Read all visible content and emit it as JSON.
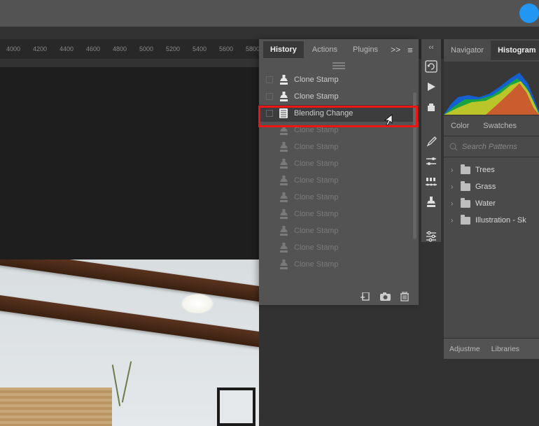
{
  "ruler_ticks": [
    "4000",
    "4200",
    "4400",
    "4600",
    "4800",
    "5000",
    "5200",
    "5400",
    "5600",
    "5800"
  ],
  "history_panel": {
    "tabs": [
      "History",
      "Actions",
      "Plugins"
    ],
    "active_tab": 0,
    "items": [
      {
        "icon": "stamp",
        "label": "Clone Stamp",
        "dim": false
      },
      {
        "icon": "stamp",
        "label": "Clone Stamp",
        "dim": false
      },
      {
        "icon": "doc",
        "label": "Blending Change",
        "dim": false,
        "selected": true
      },
      {
        "icon": "stamp",
        "label": "Clone Stamp",
        "dim": true
      },
      {
        "icon": "stamp",
        "label": "Clone Stamp",
        "dim": true
      },
      {
        "icon": "stamp",
        "label": "Clone Stamp",
        "dim": true
      },
      {
        "icon": "stamp",
        "label": "Clone Stamp",
        "dim": true
      },
      {
        "icon": "stamp",
        "label": "Clone Stamp",
        "dim": true
      },
      {
        "icon": "stamp",
        "label": "Clone Stamp",
        "dim": true
      },
      {
        "icon": "stamp",
        "label": "Clone Stamp",
        "dim": true
      },
      {
        "icon": "stamp",
        "label": "Clone Stamp",
        "dim": true
      },
      {
        "icon": "stamp",
        "label": "Clone Stamp",
        "dim": true
      }
    ]
  },
  "right_panel": {
    "top_tabs": [
      "Navigator",
      "Histogram"
    ],
    "top_active": 1,
    "color_tabs": [
      "Color",
      "Swatches"
    ],
    "search_placeholder": "Search Patterns",
    "patterns": [
      "Trees",
      "Grass",
      "Water",
      "Illustration - Sk"
    ],
    "bottom_tabs": [
      "Adjustme",
      "Libraries"
    ]
  }
}
